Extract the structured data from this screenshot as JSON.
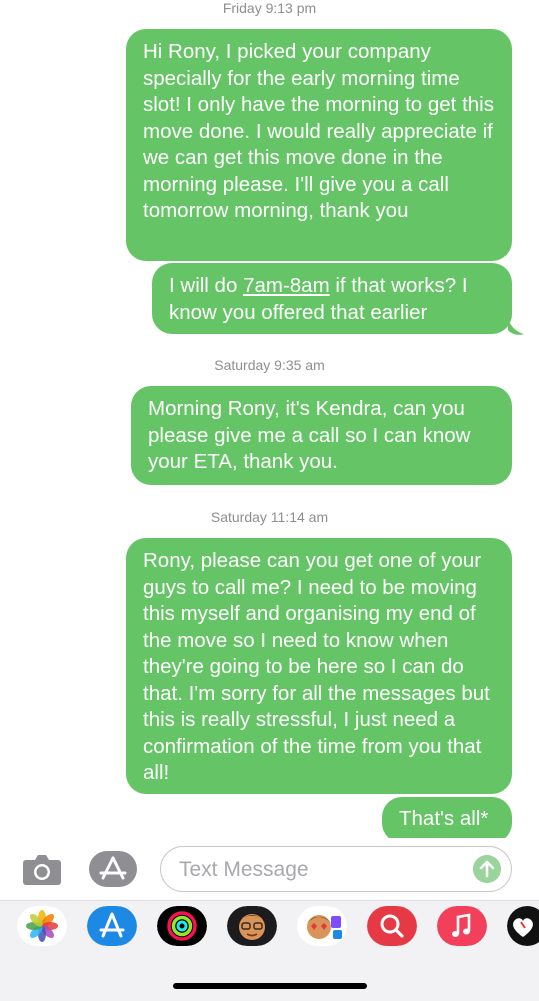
{
  "conversation": {
    "timestamp_1": "Friday 9:13 pm",
    "message_1": "Hi Rony, I picked your company specially for the early morning time slot! I only have the morning to get this move done. I would really appreciate if we can get this move done in the morning please. I'll give you a call tomorrow morning, thank you",
    "message_2_before": "I will do ",
    "message_2_link": "7am-8am",
    "message_2_after": " if that works? I know you offered that earlier",
    "timestamp_2": "Saturday 9:35 am",
    "message_3": "Morning Rony, it's Kendra, can you please give me a call so I can know your ETA, thank you.",
    "timestamp_3": "Saturday 11:14 am",
    "message_4": "Rony, please can you get one of your guys to call me? I need to be moving this myself and organising my end of the move so I need to know when they're going to be here so I can do that. I'm sorry for all the messages but this is really stressful, I just need a confirmation of the time from you that all!",
    "message_5": "That's all*"
  },
  "composer": {
    "placeholder": "Text Message",
    "value": ""
  },
  "colors": {
    "bubble_sent": "#65c466",
    "timestamp": "#8e8e93"
  },
  "app_tray": {
    "items": [
      "photos-icon",
      "app-store-icon",
      "activity-icon",
      "memoji-icon",
      "memoji-stickers-icon",
      "search-images-icon",
      "music-icon",
      "heart-app-icon"
    ]
  }
}
